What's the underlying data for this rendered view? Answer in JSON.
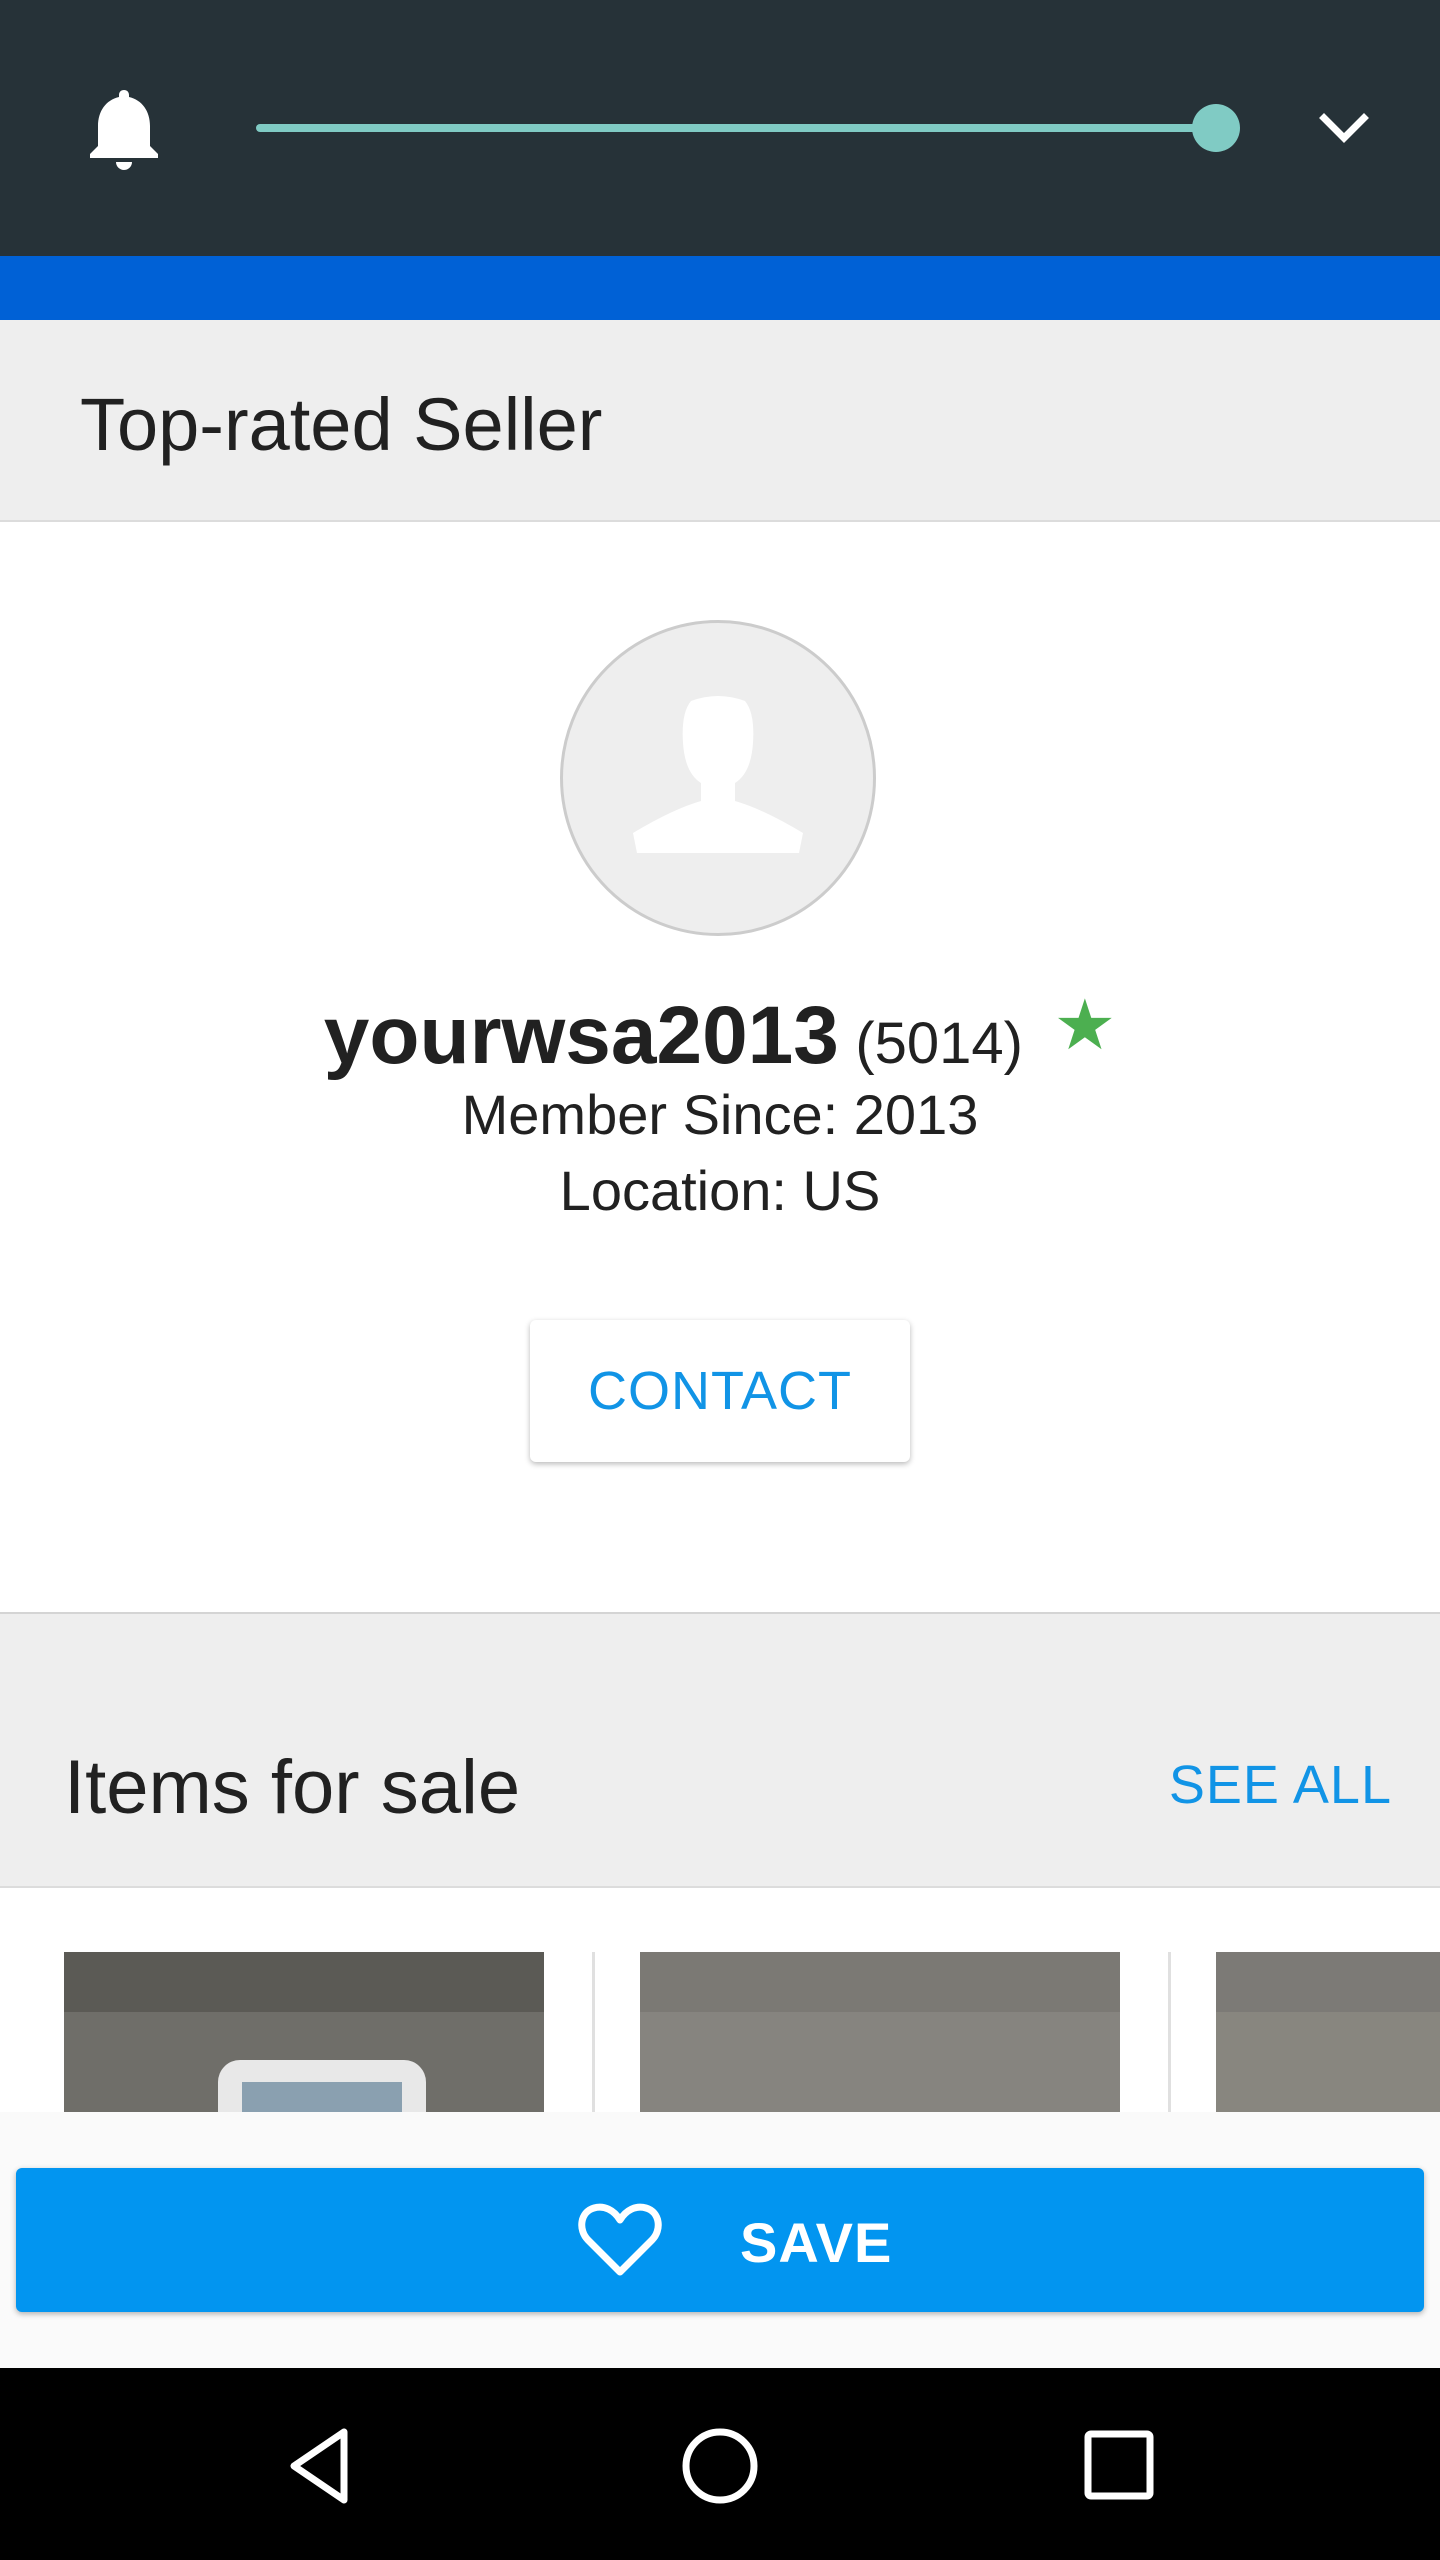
{
  "status_shade": {
    "bell_icon": "bell-icon",
    "volume_level": 1.0,
    "expand_icon": "chevron-down-icon",
    "colors": {
      "background": "#263238",
      "slider": "#80cbc4"
    }
  },
  "app_bar": {
    "color": "#0061d6"
  },
  "seller_section": {
    "title": "Top-rated Seller"
  },
  "seller": {
    "avatar_icon": "default-avatar-icon",
    "username": "yourwsa2013",
    "feedback_count": "(5014)",
    "star_icon": "star-icon",
    "star_color": "#4caf50",
    "member_since": "Member Since: 2013",
    "location": "Location: US",
    "contact_label": "CONTACT"
  },
  "items_for_sale": {
    "title": "Items for sale",
    "see_all_label": "SEE ALL",
    "thumbnails": [
      "item-thumbnail-1",
      "item-thumbnail-2",
      "item-thumbnail-3"
    ]
  },
  "save_bar": {
    "icon": "heart-outline-icon",
    "label": "SAVE",
    "color": "#0295f0"
  },
  "nav_bar": {
    "back_icon": "back-triangle-icon",
    "home_icon": "home-circle-icon",
    "recents_icon": "recents-square-icon"
  }
}
